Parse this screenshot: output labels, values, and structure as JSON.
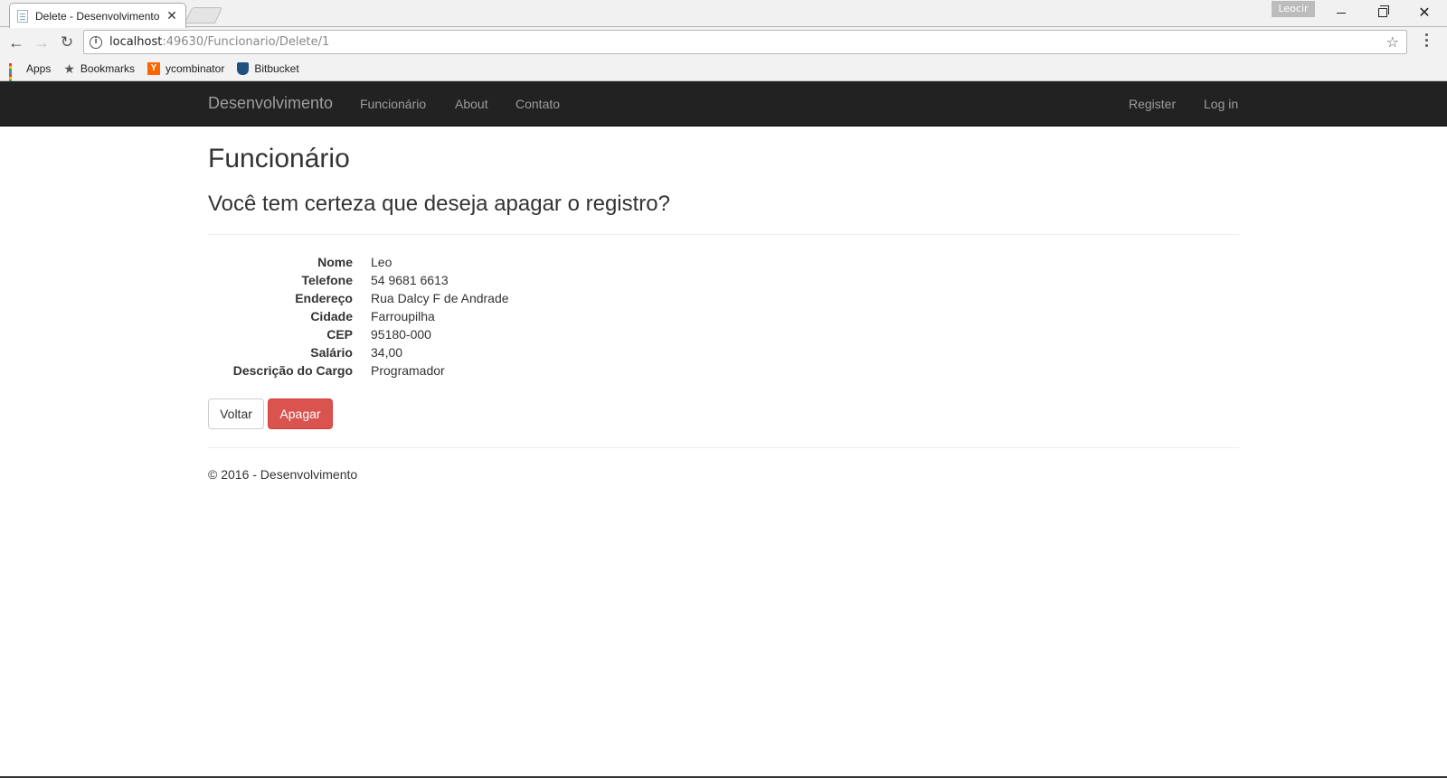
{
  "browser": {
    "tab_title": "Delete - Desenvolvimento",
    "tab_close": "✕",
    "profile_name": "Leocir",
    "url_host": "localhost",
    "url_path": ":49630/Funcionario/Delete/1",
    "bookmarks": [
      {
        "label": "Apps",
        "icon": "apps-icon"
      },
      {
        "label": "Bookmarks",
        "icon": "star-icon"
      },
      {
        "label": "ycombinator",
        "icon": "ycombinator-icon"
      },
      {
        "label": "Bitbucket",
        "icon": "bitbucket-icon"
      }
    ]
  },
  "navbar": {
    "brand": "Desenvolvimento",
    "links": [
      "Funcionário",
      "About",
      "Contato"
    ],
    "right_links": [
      "Register",
      "Log in"
    ]
  },
  "page": {
    "title": "Funcionário",
    "confirm_question": "Você tem certeza que deseja apagar o registro?",
    "fields": [
      {
        "label": "Nome",
        "value": "Leo"
      },
      {
        "label": "Telefone",
        "value": "54 9681 6613"
      },
      {
        "label": "Endereço",
        "value": "Rua Dalcy F de Andrade"
      },
      {
        "label": "Cidade",
        "value": "Farroupilha"
      },
      {
        "label": "CEP",
        "value": "95180-000"
      },
      {
        "label": "Salário",
        "value": "34,00"
      },
      {
        "label": "Descrição do Cargo",
        "value": "Programador"
      }
    ],
    "back_button": "Voltar",
    "delete_button": "Apagar"
  },
  "footer": {
    "text": "© 2016 - Desenvolvimento"
  },
  "colors": {
    "navbar_bg": "#222222",
    "danger": "#d9534f",
    "link": "#9d9d9d"
  }
}
